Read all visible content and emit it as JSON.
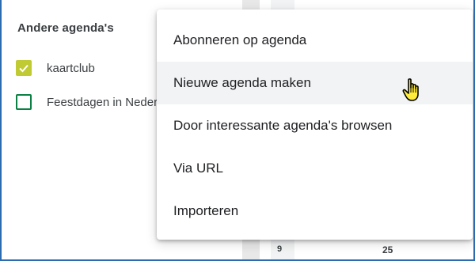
{
  "sidebar": {
    "heading": "Andere agenda's",
    "items": [
      {
        "label": "kaartclub",
        "checked": true,
        "color": "#c0ca33"
      },
      {
        "label": "Feestdagen in Nederland",
        "checked": false,
        "color": "#0b8043"
      }
    ]
  },
  "mini_calendar": {
    "week_number": "9",
    "day": "25"
  },
  "menu": {
    "items": [
      {
        "label": "Abonneren op agenda"
      },
      {
        "label": "Nieuwe agenda maken",
        "hovered": true
      },
      {
        "label": "Door interessante agenda's browsen"
      },
      {
        "label": "Via URL"
      },
      {
        "label": "Importeren"
      }
    ]
  },
  "cursor": {
    "icon": "hand-pointer-icon"
  }
}
